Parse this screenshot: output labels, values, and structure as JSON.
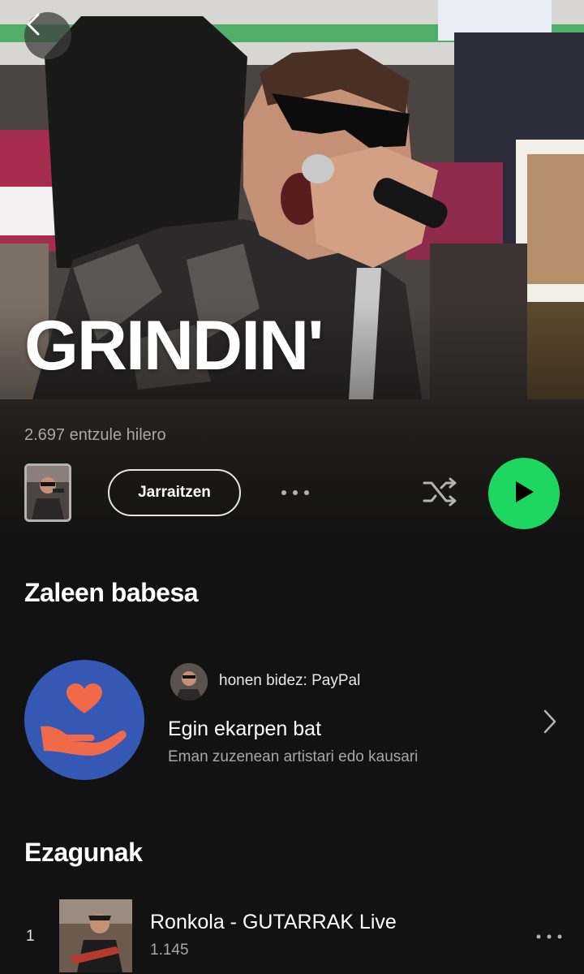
{
  "artist": {
    "name": "GRINDIN'",
    "monthly_listeners": "2.697 entzule hilero"
  },
  "actions": {
    "follow_label": "Jarraitzen",
    "more_icon": "more-horizontal-icon",
    "shuffle_icon": "shuffle-icon",
    "play_icon": "play-icon",
    "accent_color": "#1ed760"
  },
  "fan_support": {
    "title": "Zaleen babesa",
    "via": "honen bidez: PayPal",
    "card_title": "Egin ekarpen bat",
    "card_subtitle": "Eman zuzenean artistari edo kausari",
    "icon": "heart-hand-icon",
    "icon_bg": "#3558b5",
    "icon_color": "#f06a4a"
  },
  "popular": {
    "title": "Ezagunak",
    "tracks": [
      {
        "number": "1",
        "title": "Ronkola - GUTARRAK Live",
        "plays": "1.145"
      }
    ]
  }
}
